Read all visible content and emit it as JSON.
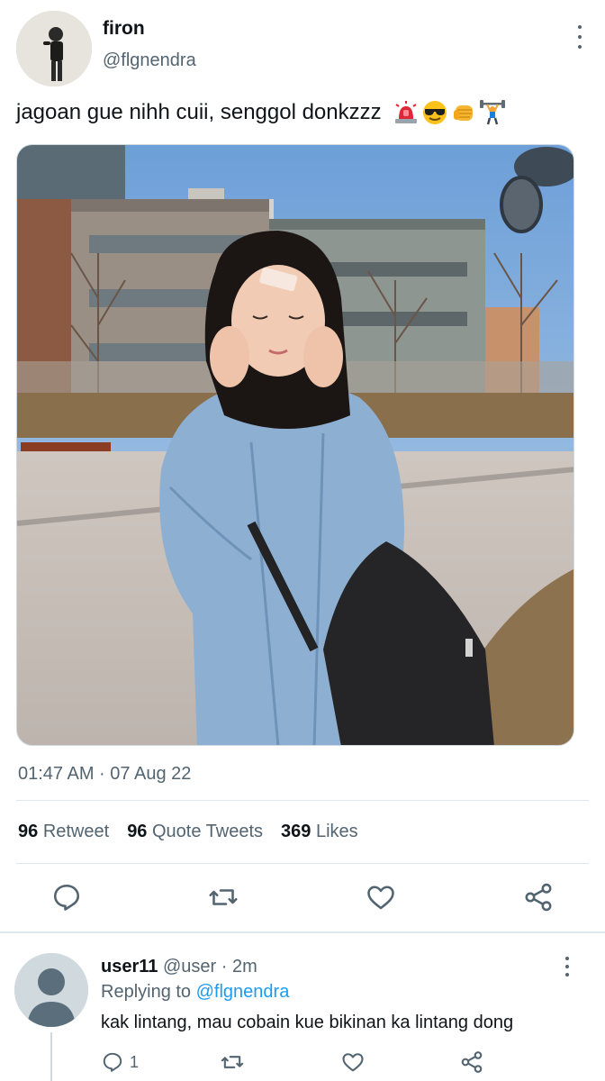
{
  "tweet": {
    "author_name": "firon",
    "author_handle": "@flgnendra",
    "text": "jagoan gue nihh cuii, senggol donkzzz",
    "emojis": [
      "police-light-icon",
      "sunglasses-face-icon",
      "fist-bump-icon",
      "weightlifter-icon"
    ],
    "timestamp": "01:47 AM · 07 Aug 22",
    "stats": {
      "retweets_count": "96",
      "retweets_label": "Retweet",
      "quotes_count": "96",
      "quotes_label": "Quote Tweets",
      "likes_count": "369",
      "likes_label": "Likes"
    },
    "actions": [
      "reply-icon",
      "retweet-icon",
      "like-icon",
      "share-icon"
    ]
  },
  "reply": {
    "author_name": "user11",
    "author_handle": "@user",
    "time": "· 2m",
    "replying_prefix": "Replying to",
    "replying_handle": "@flgnendra",
    "text": "kak lintang, mau cobain kue bikinan ka lintang dong",
    "reply_count": "1"
  },
  "colors": {
    "text_primary": "#0f1419",
    "text_secondary": "#536471",
    "link": "#1d9bf0",
    "divider": "#e1e8ed"
  }
}
